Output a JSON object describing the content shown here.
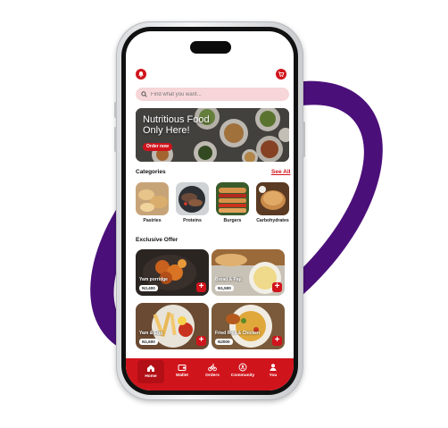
{
  "search": {
    "placeholder": "Find what you want..."
  },
  "banner": {
    "title": "Nutritious Food Only Here!",
    "cta": "Order now"
  },
  "categories": {
    "title": "Categories",
    "see_all": "See All",
    "items": [
      {
        "label": "Pastries"
      },
      {
        "label": "Proteins"
      },
      {
        "label": "Burgers"
      },
      {
        "label": "Carbohydrates"
      }
    ]
  },
  "offers": {
    "title": "Exclusive Offer",
    "items": [
      {
        "name": "Yam porridge",
        "price": "N2,400"
      },
      {
        "name": "Bread & Pap",
        "price": "N1,500"
      },
      {
        "name": "Yam & Egg",
        "price": "N1,600"
      },
      {
        "name": "Fried Rice & Chicken",
        "price": "N2000"
      }
    ]
  },
  "nav": {
    "items": [
      {
        "label": "Home",
        "icon": "home-icon"
      },
      {
        "label": "Wallet",
        "icon": "wallet-icon"
      },
      {
        "label": "Orders",
        "icon": "bike-icon"
      },
      {
        "label": "Community",
        "icon": "community-icon"
      },
      {
        "label": "You",
        "icon": "user-icon"
      }
    ],
    "active": "Home"
  },
  "colors": {
    "brand": "#d0141c",
    "ring": "#4b0f7a",
    "search_bg": "#f6d6d8"
  }
}
